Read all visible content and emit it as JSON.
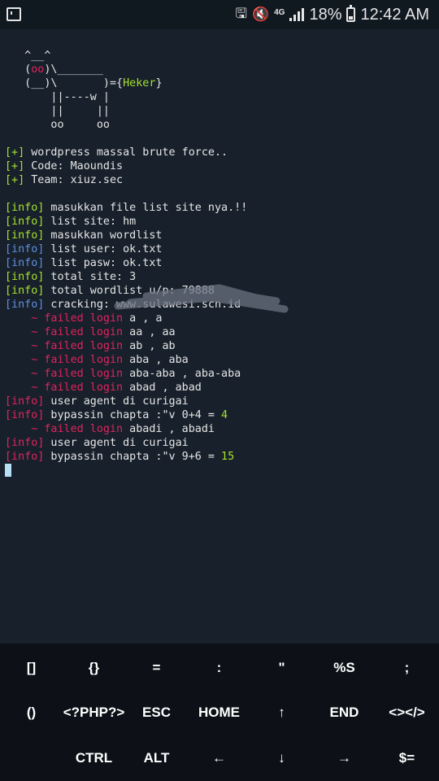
{
  "status_bar": {
    "net": "4G",
    "battery": "18%",
    "time": "12:42 AM"
  },
  "terminal": {
    "art": {
      "l1": "   ^__^",
      "l2a": "   (",
      "l2b": "oo",
      "l2c": ")\\_______",
      "l3a": "   (__)\\       )={",
      "l3b": "Heker",
      "l3c": "}",
      "l4": "       ||----w |",
      "l5": "       ||     ||",
      "l6": "       oo     oo"
    },
    "plus": "[+]",
    "info": "[info]",
    "tilde": "~",
    "failed": "failed login",
    "banner1": " wordpress massal brute force..",
    "banner2": " Code: Maoundis",
    "banner3": " Team: xiuz.sec",
    "i1": " masukkan file list site nya.!!",
    "i2": " list site: hm",
    "i3": " masukkan wordlist",
    "i4": " list user: ok.txt",
    "i5": " list pasw: ok.txt",
    "i6": " total site: 3",
    "i7": " total wordlist u/p: 79888",
    "i8": " cracking: www.",
    "i8b": "sulawesi.scn.id",
    "f1": " a , a",
    "f2": " aa , aa",
    "f3": " ab , ab",
    "f4": " aba , aba",
    "f5": " aba-aba , aba-aba",
    "f6": " abad , abad",
    "i9": " user agent di curigai",
    "i10": " bypassin chapta :\"v 0+4 = ",
    "n1": "4",
    "f7": " abadi , abadi",
    "i11": " user agent di curigai",
    "i12": " bypassin chapta :\"v 9+6 = ",
    "n2": "15"
  },
  "keys": {
    "row1": [
      "[]",
      "{}",
      "=",
      ":",
      "\"",
      "%S",
      ";"
    ],
    "row2": [
      "()",
      "<?PHP?>",
      "ESC",
      "HOME",
      "↑",
      "END",
      "<></>"
    ],
    "row3": [
      "CTRL",
      "ALT",
      "←",
      "↓",
      "→",
      "$="
    ]
  }
}
